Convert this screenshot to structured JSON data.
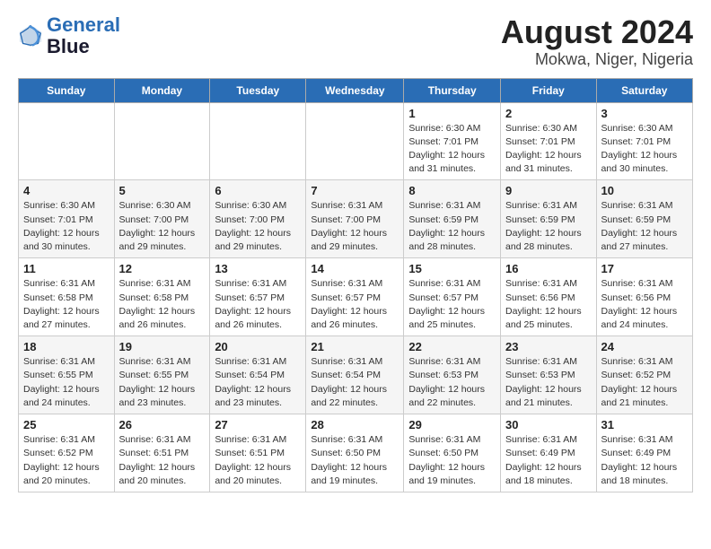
{
  "header": {
    "logo_line1": "General",
    "logo_line2": "Blue",
    "title": "August 2024",
    "subtitle": "Mokwa, Niger, Nigeria"
  },
  "days_of_week": [
    "Sunday",
    "Monday",
    "Tuesday",
    "Wednesday",
    "Thursday",
    "Friday",
    "Saturday"
  ],
  "weeks": [
    [
      {
        "day": "",
        "info": ""
      },
      {
        "day": "",
        "info": ""
      },
      {
        "day": "",
        "info": ""
      },
      {
        "day": "",
        "info": ""
      },
      {
        "day": "1",
        "info": "Sunrise: 6:30 AM\nSunset: 7:01 PM\nDaylight: 12 hours\nand 31 minutes."
      },
      {
        "day": "2",
        "info": "Sunrise: 6:30 AM\nSunset: 7:01 PM\nDaylight: 12 hours\nand 31 minutes."
      },
      {
        "day": "3",
        "info": "Sunrise: 6:30 AM\nSunset: 7:01 PM\nDaylight: 12 hours\nand 30 minutes."
      }
    ],
    [
      {
        "day": "4",
        "info": "Sunrise: 6:30 AM\nSunset: 7:01 PM\nDaylight: 12 hours\nand 30 minutes."
      },
      {
        "day": "5",
        "info": "Sunrise: 6:30 AM\nSunset: 7:00 PM\nDaylight: 12 hours\nand 29 minutes."
      },
      {
        "day": "6",
        "info": "Sunrise: 6:30 AM\nSunset: 7:00 PM\nDaylight: 12 hours\nand 29 minutes."
      },
      {
        "day": "7",
        "info": "Sunrise: 6:31 AM\nSunset: 7:00 PM\nDaylight: 12 hours\nand 29 minutes."
      },
      {
        "day": "8",
        "info": "Sunrise: 6:31 AM\nSunset: 6:59 PM\nDaylight: 12 hours\nand 28 minutes."
      },
      {
        "day": "9",
        "info": "Sunrise: 6:31 AM\nSunset: 6:59 PM\nDaylight: 12 hours\nand 28 minutes."
      },
      {
        "day": "10",
        "info": "Sunrise: 6:31 AM\nSunset: 6:59 PM\nDaylight: 12 hours\nand 27 minutes."
      }
    ],
    [
      {
        "day": "11",
        "info": "Sunrise: 6:31 AM\nSunset: 6:58 PM\nDaylight: 12 hours\nand 27 minutes."
      },
      {
        "day": "12",
        "info": "Sunrise: 6:31 AM\nSunset: 6:58 PM\nDaylight: 12 hours\nand 26 minutes."
      },
      {
        "day": "13",
        "info": "Sunrise: 6:31 AM\nSunset: 6:57 PM\nDaylight: 12 hours\nand 26 minutes."
      },
      {
        "day": "14",
        "info": "Sunrise: 6:31 AM\nSunset: 6:57 PM\nDaylight: 12 hours\nand 26 minutes."
      },
      {
        "day": "15",
        "info": "Sunrise: 6:31 AM\nSunset: 6:57 PM\nDaylight: 12 hours\nand 25 minutes."
      },
      {
        "day": "16",
        "info": "Sunrise: 6:31 AM\nSunset: 6:56 PM\nDaylight: 12 hours\nand 25 minutes."
      },
      {
        "day": "17",
        "info": "Sunrise: 6:31 AM\nSunset: 6:56 PM\nDaylight: 12 hours\nand 24 minutes."
      }
    ],
    [
      {
        "day": "18",
        "info": "Sunrise: 6:31 AM\nSunset: 6:55 PM\nDaylight: 12 hours\nand 24 minutes."
      },
      {
        "day": "19",
        "info": "Sunrise: 6:31 AM\nSunset: 6:55 PM\nDaylight: 12 hours\nand 23 minutes."
      },
      {
        "day": "20",
        "info": "Sunrise: 6:31 AM\nSunset: 6:54 PM\nDaylight: 12 hours\nand 23 minutes."
      },
      {
        "day": "21",
        "info": "Sunrise: 6:31 AM\nSunset: 6:54 PM\nDaylight: 12 hours\nand 22 minutes."
      },
      {
        "day": "22",
        "info": "Sunrise: 6:31 AM\nSunset: 6:53 PM\nDaylight: 12 hours\nand 22 minutes."
      },
      {
        "day": "23",
        "info": "Sunrise: 6:31 AM\nSunset: 6:53 PM\nDaylight: 12 hours\nand 21 minutes."
      },
      {
        "day": "24",
        "info": "Sunrise: 6:31 AM\nSunset: 6:52 PM\nDaylight: 12 hours\nand 21 minutes."
      }
    ],
    [
      {
        "day": "25",
        "info": "Sunrise: 6:31 AM\nSunset: 6:52 PM\nDaylight: 12 hours\nand 20 minutes."
      },
      {
        "day": "26",
        "info": "Sunrise: 6:31 AM\nSunset: 6:51 PM\nDaylight: 12 hours\nand 20 minutes."
      },
      {
        "day": "27",
        "info": "Sunrise: 6:31 AM\nSunset: 6:51 PM\nDaylight: 12 hours\nand 20 minutes."
      },
      {
        "day": "28",
        "info": "Sunrise: 6:31 AM\nSunset: 6:50 PM\nDaylight: 12 hours\nand 19 minutes."
      },
      {
        "day": "29",
        "info": "Sunrise: 6:31 AM\nSunset: 6:50 PM\nDaylight: 12 hours\nand 19 minutes."
      },
      {
        "day": "30",
        "info": "Sunrise: 6:31 AM\nSunset: 6:49 PM\nDaylight: 12 hours\nand 18 minutes."
      },
      {
        "day": "31",
        "info": "Sunrise: 6:31 AM\nSunset: 6:49 PM\nDaylight: 12 hours\nand 18 minutes."
      }
    ]
  ]
}
